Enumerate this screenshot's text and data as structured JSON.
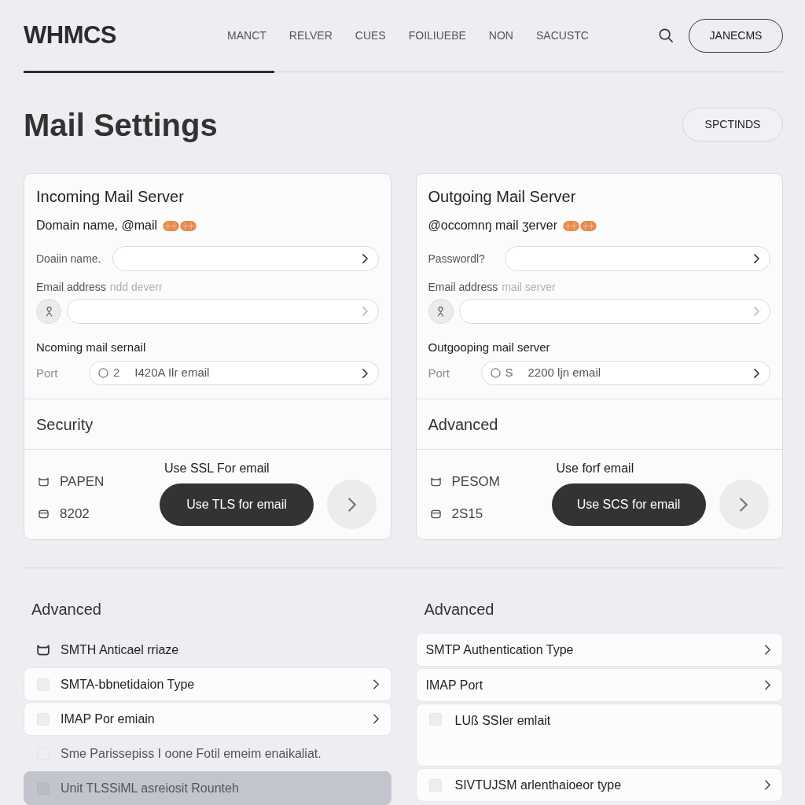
{
  "header": {
    "logo": "WHMCS",
    "nav": [
      "MANCT",
      "RELVER",
      "CUES",
      "FOILIUEBE",
      "NON",
      "SACUSTC"
    ],
    "account_button": "JANECMS",
    "progress": {
      "level": 0.33
    }
  },
  "page": {
    "title": "Mail Settings",
    "action_button": "SPCTINDS"
  },
  "cards": [
    {
      "title": "Incoming Mail Server",
      "subtitle": "Domain name, @mail",
      "field_1": {
        "label": "Doaiin name."
      },
      "field_2": {
        "label": "Email address",
        "hint": "ndd deverr"
      },
      "group_label": "Ncoming mail sernail",
      "port": {
        "label": "Port",
        "radio_checked": false,
        "value_1": "2",
        "value_2": "I420A Ilr email"
      },
      "section_title": "Security",
      "items": [
        "PAPEN",
        "8202"
      ],
      "option_label": "Use SSL For email",
      "primary_button": "Use TLS for email"
    },
    {
      "title": "Outgoing Mail Server",
      "subtitle": "@occomnŋ mail ʒerver",
      "field_1": {
        "label": "Passwordl?"
      },
      "field_2": {
        "label": "Email address",
        "hint": "mail server"
      },
      "group_label": "Outgooping mail server",
      "port": {
        "label": "Port",
        "radio_checked": false,
        "value_1": "S",
        "value_2": "2200 ljn email"
      },
      "section_title": "Advanced",
      "items": [
        "PESOM",
        "2S15"
      ],
      "option_label": "Use forf email",
      "primary_button": "Use SCS for email"
    }
  ],
  "advanced_panels": [
    {
      "title": "Advanced",
      "items": [
        {
          "kind": "icon",
          "label": "SMTH Anticael rriaze",
          "selected": false,
          "chevron": false
        },
        {
          "kind": "card",
          "label": "SMTA-bbnetidaion Type",
          "checked": false,
          "selected": false,
          "chevron": true
        },
        {
          "kind": "card",
          "label": "IMAP Por emiain",
          "checked": false,
          "selected": false,
          "chevron": true
        },
        {
          "kind": "bare",
          "label": "Sme Parissepiss I oone Fotil emeim enaikaliat.",
          "checked": false,
          "selected": false,
          "chevron": false
        },
        {
          "kind": "card",
          "label": "Unit TLSSiML asreiosit Rounteh",
          "checked": false,
          "selected": true,
          "chevron": false
        }
      ]
    },
    {
      "title": "Advanced",
      "items": [
        {
          "kind": "card",
          "label": "SMTP Authentication Type",
          "selected": false,
          "chevron": true
        },
        {
          "kind": "card",
          "label": "IMAP Port",
          "selected": false,
          "chevron": true
        },
        {
          "kind": "tall",
          "label": "LUß SSIer emlait",
          "checked": false,
          "selected": false,
          "chevron": false
        },
        {
          "kind": "card",
          "label": "SIVTUJSM arlenthaioeor type",
          "checked": false,
          "selected": false,
          "chevron": true
        }
      ]
    }
  ]
}
